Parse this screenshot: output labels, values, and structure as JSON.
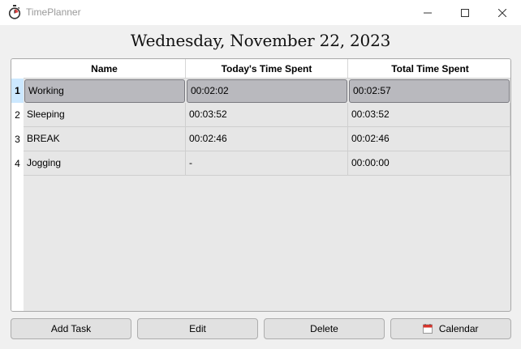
{
  "window": {
    "title": "TimePlanner",
    "icon": "stopwatch-icon"
  },
  "date_header": "Wednesday, November 22, 2023",
  "table": {
    "columns": [
      "Name",
      "Today's Time Spent",
      "Total Time Spent"
    ],
    "rows": [
      {
        "num": "1",
        "name": "Working",
        "today": "00:02:02",
        "total": "00:02:57",
        "selected": true
      },
      {
        "num": "2",
        "name": "Sleeping",
        "today": "00:03:52",
        "total": "00:03:52",
        "selected": false
      },
      {
        "num": "3",
        "name": "BREAK",
        "today": "00:02:46",
        "total": "00:02:46",
        "selected": false
      },
      {
        "num": "4",
        "name": "Jogging",
        "today": "-",
        "total": "00:00:00",
        "selected": false
      }
    ]
  },
  "buttons": {
    "add": "Add Task",
    "edit": "Edit",
    "delete": "Delete",
    "calendar": "Calendar",
    "calendar_icon": "calendar-icon"
  },
  "colors": {
    "selection": "#b9b9be",
    "row_header_selected": "#cce8ff"
  }
}
